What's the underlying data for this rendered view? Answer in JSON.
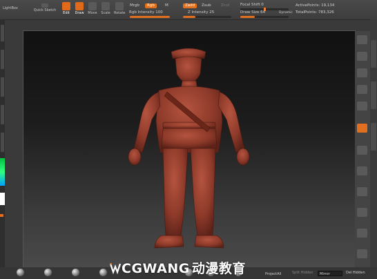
{
  "toolbar": {
    "lightbox_label": "LightBox",
    "quick_sketch_label": "Quick Sketch",
    "edit_label": "Edit",
    "draw_label": "Draw",
    "move_label": "Move",
    "scale_label": "Scale",
    "rotate_label": "Rotate",
    "mrgb_label": "Mrgb",
    "rgb_label": "Rgb",
    "m_label": "M",
    "zadd_label": "Zadd",
    "zsub_label": "Zsub",
    "zcut_label": "Zcut",
    "rgb_intensity_label": "Rgb Intensity 100",
    "z_intensity_label": "Z Intensity 25",
    "focal_shift_label": "Focal Shift 0",
    "draw_size_label": "Draw Size 64",
    "dynamic_label": "Dynamic",
    "active_points_label": "ActivePoints: 19,134",
    "total_points_label": "TotalPoints: 783,326"
  },
  "sliders": {
    "rgb_intensity": 1.0,
    "z_intensity": 0.25,
    "focal_shift": 0.5,
    "draw_size": 0.3
  },
  "bottom": {
    "projectall_label": "ProjectAll",
    "split_hidden_label": "Split Hidden",
    "mirror_label": "Mirror",
    "del_hidden_label": "Del Hidden"
  },
  "watermark": {
    "latin": "CGWANG",
    "chinese": "动漫教育"
  },
  "colors": {
    "accent": "#e0701e",
    "model": "#9a4030"
  }
}
